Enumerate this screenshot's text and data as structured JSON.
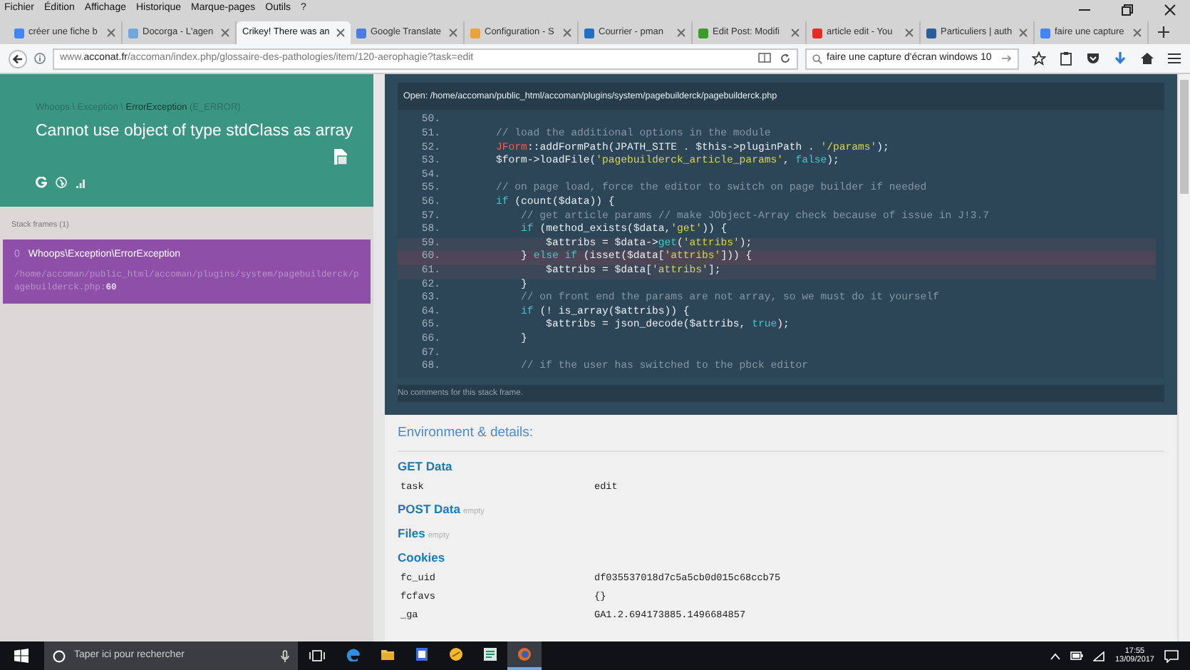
{
  "browser": {
    "menu": [
      "Fichier",
      "Édition",
      "Affichage",
      "Historique",
      "Marque-pages",
      "Outils",
      "?"
    ],
    "tabs": [
      {
        "title": "créer une fiche b",
        "color": "#4285f4",
        "selected": false
      },
      {
        "title": "Docorga - L'agen",
        "color": "#6fa8dc",
        "selected": false
      },
      {
        "title": "Crikey! There was an",
        "selected": true
      },
      {
        "title": "Google Translate",
        "color": "#4a7de0",
        "selected": false
      },
      {
        "title": "Configuration - S",
        "color": "#e8a33a",
        "selected": false
      },
      {
        "title": "Courrier - pman",
        "color": "#1f6fc5",
        "selected": false
      },
      {
        "title": "Edit Post: Modifi",
        "color": "#3a9a2a",
        "selected": false
      },
      {
        "title": "article edit - You",
        "color": "#e52d27",
        "selected": false
      },
      {
        "title": "Particuliers | auth",
        "color": "#2b5d9b",
        "selected": false
      },
      {
        "title": "faire une capture",
        "color": "#4285f4",
        "selected": false
      }
    ],
    "url": "www.**acconat.fr**/accoman/index.php/glossaire-des-pathologies/item/120-aerophagie?task=edit",
    "search_value": "faire une capture d'écran windows 10"
  },
  "error": {
    "namespace": "Whoops \\ Exception \\",
    "class": "ErrorException",
    "code": "(E_ERROR)",
    "message": "Cannot use object of type stdClass as array"
  },
  "stack": {
    "label": "Stack frames (1)",
    "frames": [
      {
        "index": "0",
        "class": "Whoops\\Exception\\ErrorException",
        "location": "/home/accoman/public_html/accoman/plugins/system/pagebuilderck/pagebuilderck.php:**60**",
        "selected": true
      }
    ]
  },
  "code": {
    "file_label": "Open: /home/accoman/public_html/accoman/plugins/system/pagebuilderck/pagebuilderck.php",
    "comment": "No comments for this stack frame.",
    "lines": [
      {
        "number": "50.",
        "marked": false,
        "selected": false
      },
      {
        "number": "51.",
        "tokens": [
          {
            "t": "        // load the additional options in the module",
            "kind": "comment"
          }
        ],
        "marked": false,
        "selected": false
      },
      {
        "number": "52.",
        "tokens": [
          {
            "t": "        JForm",
            "kind": "class"
          },
          {
            "t": "::addFormPath(JPATH_SITE . $this->pluginPath . ",
            "kind": "plain"
          },
          {
            "t": "'/params'",
            "kind": "string"
          },
          {
            "t": ");",
            "kind": "plain"
          }
        ],
        "marked": false,
        "selected": false
      },
      {
        "number": "53.",
        "tokens": [
          {
            "t": "        $form->loadFile(",
            "kind": "plain"
          },
          {
            "t": "'pagebuilderck_article_params'",
            "kind": "string"
          },
          {
            "t": ", ",
            "kind": "plain"
          },
          {
            "t": "false",
            "kind": "keyword"
          },
          {
            "t": ");",
            "kind": "plain"
          }
        ],
        "marked": false,
        "selected": false
      },
      {
        "number": "54.",
        "marked": false,
        "selected": false
      },
      {
        "number": "55.",
        "tokens": [
          {
            "t": "        // on page load, force the editor to switch on page builder if needed",
            "kind": "comment"
          }
        ],
        "marked": false,
        "selected": false
      },
      {
        "number": "56.",
        "tokens": [
          {
            "t": "        if",
            "kind": "keyword"
          },
          {
            "t": " (count($data)) {",
            "kind": "plain"
          }
        ],
        "marked": false,
        "selected": false
      },
      {
        "number": "57.",
        "tokens": [
          {
            "t": "            // get article params // make JObject-Array check because of issue in J!3.7",
            "kind": "comment"
          }
        ],
        "marked": false,
        "selected": false
      },
      {
        "number": "58.",
        "tokens": [
          {
            "t": "            if",
            "kind": "keyword"
          },
          {
            "t": " (method_exists($data,",
            "kind": "plain"
          },
          {
            "t": "'get'",
            "kind": "string"
          },
          {
            "t": ")) {",
            "kind": "plain"
          }
        ],
        "marked": false,
        "selected": false
      },
      {
        "number": "59.",
        "tokens": [
          {
            "t": "                $attribs = $data->",
            "kind": "plain"
          },
          {
            "t": "get",
            "kind": "keyword"
          },
          {
            "t": "(",
            "kind": "plain"
          },
          {
            "t": "'attribs'",
            "kind": "string"
          },
          {
            "t": ");",
            "kind": "plain"
          }
        ],
        "marked": true,
        "selected": false
      },
      {
        "number": "60.",
        "tokens": [
          {
            "t": "            } ",
            "kind": "plain"
          },
          {
            "t": "else if",
            "kind": "keyword"
          },
          {
            "t": " (isset($data[",
            "kind": "plain"
          },
          {
            "t": "'attribs'",
            "kind": "string"
          },
          {
            "t": "])) {",
            "kind": "plain"
          }
        ],
        "marked": true,
        "selected": true
      },
      {
        "number": "61.",
        "tokens": [
          {
            "t": "                $attribs = $data[",
            "kind": "plain"
          },
          {
            "t": "'attribs'",
            "kind": "string"
          },
          {
            "t": "];",
            "kind": "plain"
          }
        ],
        "marked": true,
        "selected": false
      },
      {
        "number": "62.",
        "tokens": [
          {
            "t": "            }",
            "kind": "plain"
          }
        ],
        "marked": false,
        "selected": false
      },
      {
        "number": "63.",
        "tokens": [
          {
            "t": "            // on front end the params are not array, so we must do it yourself",
            "kind": "comment"
          }
        ],
        "marked": false,
        "selected": false
      },
      {
        "number": "64.",
        "tokens": [
          {
            "t": "            if",
            "kind": "keyword"
          },
          {
            "t": " (! is_array($attribs)) {",
            "kind": "plain"
          }
        ],
        "marked": false,
        "selected": false
      },
      {
        "number": "65.",
        "tokens": [
          {
            "t": "                $attribs = json_decode($attribs, ",
            "kind": "plain"
          },
          {
            "t": "true",
            "kind": "keyword"
          },
          {
            "t": ");",
            "kind": "plain"
          }
        ],
        "marked": false,
        "selected": false
      },
      {
        "number": "66.",
        "tokens": [
          {
            "t": "            }",
            "kind": "plain"
          }
        ],
        "marked": false,
        "selected": false
      },
      {
        "number": "67.",
        "marked": false,
        "selected": false
      },
      {
        "number": "68.",
        "tokens": [
          {
            "t": "            // if the user has switched to the pbck editor",
            "kind": "comment"
          }
        ],
        "marked": false,
        "selected": false
      }
    ]
  },
  "environment": {
    "title": "Environment & details:",
    "sections": [
      {
        "title": "GET Data",
        "rows": [
          {
            "key": "task",
            "value": "edit"
          }
        ]
      },
      {
        "title": "POST Data",
        "note": "empty"
      },
      {
        "title": "Files",
        "note": "empty"
      },
      {
        "title": "Cookies",
        "rows": [
          {
            "key": "fc_uid",
            "value": "df035537018d7c5a5cb0d015c68ccb75"
          },
          {
            "key": "fcfavs",
            "value": "{}"
          },
          {
            "key": "_ga",
            "value": "GA1.2.694173885.1496684857"
          }
        ]
      }
    ]
  },
  "taskbar": {
    "search_placeholder": "Taper ici pour rechercher",
    "apps": [
      {
        "kind": "edge",
        "active": false
      },
      {
        "kind": "folder",
        "active": false
      },
      {
        "kind": "document",
        "active": false
      },
      {
        "kind": "disc",
        "active": false
      },
      {
        "kind": "notes",
        "active": false
      },
      {
        "kind": "firefox",
        "active": true
      }
    ],
    "time": "17:55",
    "date": "13/09/2017"
  }
}
